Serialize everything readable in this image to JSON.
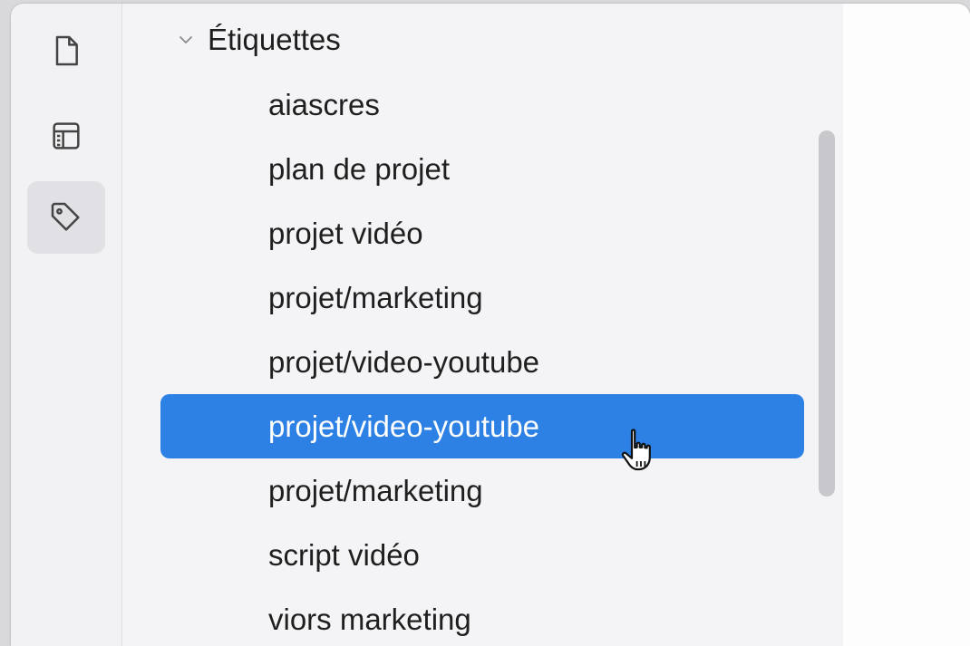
{
  "sidebar": {
    "section_title": "Étiquettes",
    "section_expanded": true,
    "selected_index": 5,
    "tags": [
      {
        "label": "aiascres"
      },
      {
        "label": "plan de projet"
      },
      {
        "label": "projet vidéo"
      },
      {
        "label": "projet/marketing"
      },
      {
        "label": "projet/video-youtube"
      },
      {
        "label": "projet/video-youtube"
      },
      {
        "label": "projet/marketing"
      },
      {
        "label": "script vidéo"
      },
      {
        "label": "viors marketing"
      }
    ]
  },
  "icon_rail": {
    "items": [
      {
        "icon": "file-icon",
        "active": false
      },
      {
        "icon": "table-layout-icon",
        "active": false
      },
      {
        "icon": "tag-icon",
        "active": true
      }
    ]
  },
  "colors": {
    "selection": "#2d80e4",
    "selection_text": "#ffffff",
    "sidebar_bg": "#f4f4f6",
    "text": "#1f1f1f"
  }
}
